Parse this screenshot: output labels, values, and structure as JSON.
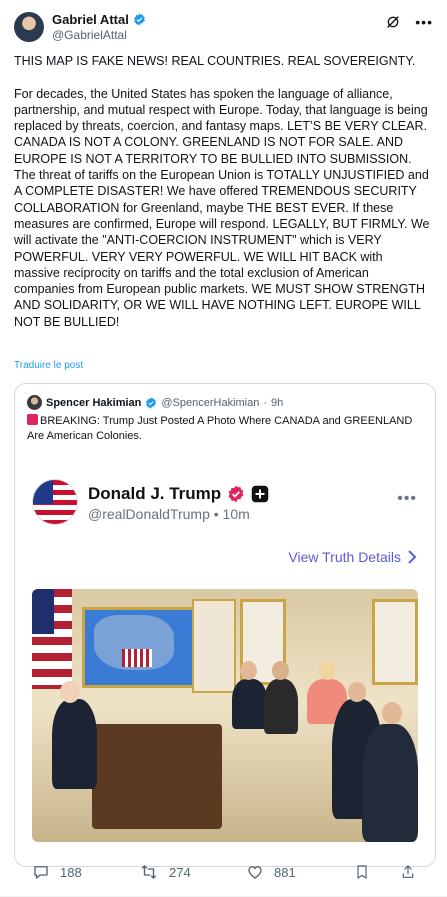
{
  "author": {
    "name": "Gabriel Attal",
    "handle": "@GabrielAttal"
  },
  "post": {
    "text": "THIS MAP IS FAKE NEWS! REAL COUNTRIES. REAL SOVEREIGNTY.\n\nFor decades, the United States has spoken the language of alliance, partnership, and mutual respect with Europe. Today, that language is being replaced by threats, coercion, and fantasy maps. LET’S BE VERY CLEAR. CANADA IS NOT A COLONY. GREENLAND IS NOT FOR SALE. AND EUROPE IS NOT A TERRITORY TO BE BULLIED INTO SUBMISSION. The threat of tariffs on the European Union is TOTALLY UNJUSTIFIED and A COMPLETE DISASTER! We have offered TREMENDOUS SECURITY COLLABORATION for Greenland, maybe THE BEST EVER. If these measures are confirmed, Europe will respond. LEGALLY, BUT FIRMLY. We will activate the \"ANTI-COERCION INSTRUMENT\" which is VERY POWERFUL. VERY VERY POWERFUL. WE WILL HIT BACK with massive reciprocity on tariffs and the total exclusion of American companies from European public markets. WE MUST SHOW STRENGTH AND SOLIDARITY, OR WE WILL HAVE NOTHING LEFT. EUROPE WILL NOT BE BULLIED!",
    "translate_label": "Traduire le post"
  },
  "quote": {
    "name": "Spencer Hakimian",
    "handle": "@SpencerHakimian",
    "time": "9h",
    "text": "BREAKING: Trump Just Posted A Photo Where CANADA and GREENLAND Are American Colonies.",
    "embed": {
      "name": "Donald J. Trump",
      "handle": "@realDonaldTrump",
      "time": "10m",
      "link_label": "View Truth Details"
    }
  },
  "actions": {
    "replies": "188",
    "reposts": "274",
    "likes": "881"
  },
  "colors": {
    "link": "#1d9bf0",
    "verified": "#1d9bf0",
    "truth_link": "#5b5bd6",
    "truth_badge": "#e0245e"
  }
}
